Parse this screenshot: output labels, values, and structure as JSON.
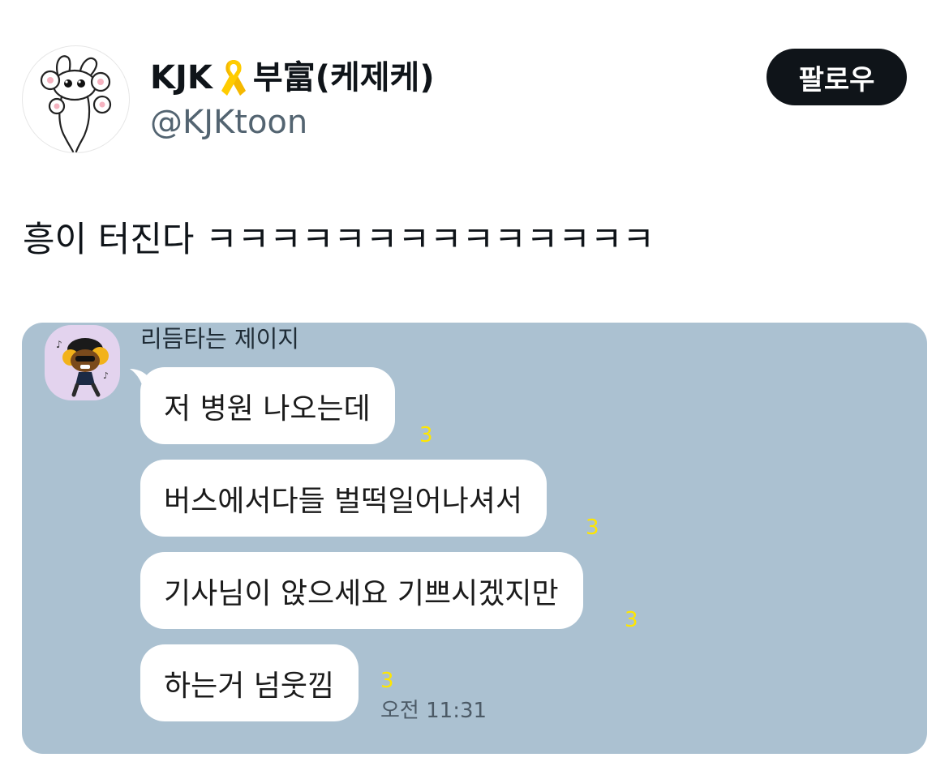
{
  "tweet": {
    "author": {
      "name_prefix": "KJK",
      "name_suffix": "부富(케제케)",
      "ribbon_icon": "yellow-ribbon-icon",
      "handle": "@KJKtoon",
      "avatar_icon": "bunny-cartoon-avatar"
    },
    "follow_label": "팔로우",
    "text": "흥이 터진다 ㅋㅋㅋㅋㅋㅋㅋㅋㅋㅋㅋㅋㅋㅋ"
  },
  "chat": {
    "background_color": "#abc1d1",
    "sender_name": "리듬타는 제이지",
    "sender_avatar_icon": "dancing-character-avatar",
    "messages": [
      {
        "text": "저 병원 나오는데",
        "unread": "3"
      },
      {
        "text": "버스에서다들 벌떡일어나셔서",
        "unread": "3"
      },
      {
        "text": "기사님이 앉으세요 기쁘시겠지만",
        "unread": "3"
      },
      {
        "text": "하는거 넘웃낌",
        "unread": "3"
      }
    ],
    "timestamp": "오전 11:31"
  }
}
